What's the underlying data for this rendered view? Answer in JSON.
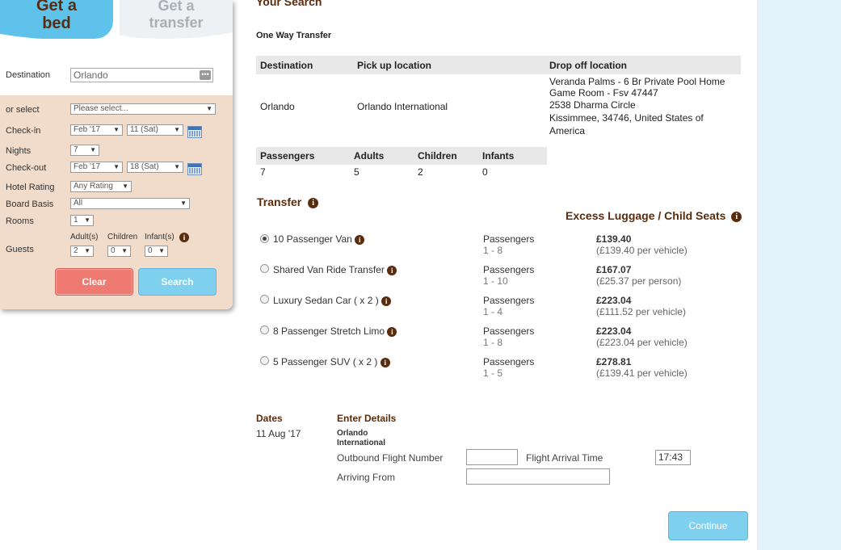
{
  "colors": {
    "brand_brown": "#5a2c0e",
    "sky": "#5ec2ea",
    "panel_bg": "#f1dccc",
    "clear_red": "#ef7a72",
    "search_blue": "#7fd0ef",
    "side_strip": "#e3f3fb"
  },
  "tabs": {
    "bed_line1": "Get a",
    "bed_line2": "bed",
    "transfer_line1": "Get a",
    "transfer_line2": "transfer"
  },
  "search_form": {
    "destination_label": "Destination",
    "destination_value": "Orlando",
    "destination_btn": "•••",
    "or_select_label": "or select",
    "or_select_value": "Please select...",
    "checkin_label": "Check-in",
    "checkin_month": "Feb '17",
    "checkin_day": "11 (Sat)",
    "nights_label": "Nights",
    "nights_value": "7",
    "checkout_label": "Check-out",
    "checkout_month": "Feb '17",
    "checkout_day": "18 (Sat)",
    "rating_label": "Hotel Rating",
    "rating_value": "Any Rating",
    "board_label": "Board Basis",
    "board_value": "All",
    "rooms_label": "Rooms",
    "rooms_value": "1",
    "guests_label": "Guests",
    "adults_label": "Adult(s)",
    "adults_value": "2",
    "children_label": "Children",
    "children_value": "0",
    "infants_label": "Infant(s)",
    "infants_value": "0",
    "clear_label": "Clear",
    "search_label": "Search"
  },
  "summary": {
    "title": "Your Search",
    "subtitle": "One Way Transfer",
    "headers": [
      "Destination",
      "Pick up location",
      "Drop off location"
    ],
    "destination": "Orlando",
    "pickup": "Orlando International",
    "dropoff_lines": [
      "Veranda Palms - 6 Br Private Pool Home",
      "Game Room - Fsv 47447",
      "2538 Dharma Circle",
      "Kissimmee, 34746, United States of",
      "America"
    ],
    "pax_headers": [
      "Passengers",
      "Adults",
      "Children",
      "Infants"
    ],
    "pax_values": [
      "7",
      "5",
      "2",
      "0"
    ]
  },
  "transfer": {
    "heading": "Transfer",
    "excess_heading": "Excess Luggage / Child Seats",
    "passengers_label": "Passengers",
    "options": [
      {
        "name": "10 Passenger Van",
        "pax": "1 - 8",
        "price": "£139.40",
        "note": "(£139.40 per vehicle)",
        "selected": true
      },
      {
        "name": "Shared Van Ride Transfer",
        "pax": "1 - 10",
        "price": "£167.07",
        "note": "(£25.37 per person)",
        "selected": false
      },
      {
        "name": "Luxury Sedan Car ( x 2 )",
        "pax": "1 - 4",
        "price": "£223.04",
        "note": "(£111.52 per vehicle)",
        "selected": false
      },
      {
        "name": "8 Passenger Stretch Limo",
        "pax": "1 - 8",
        "price": "£223.04",
        "note": "(£223.04 per vehicle)",
        "selected": false
      },
      {
        "name": "5 Passenger SUV ( x 2 )",
        "pax": "1 - 5",
        "price": "£278.81",
        "note": "(£139.41 per vehicle)",
        "selected": false
      }
    ]
  },
  "details": {
    "dates_label": "Dates",
    "date_value": "11 Aug '17",
    "enter_label": "Enter Details",
    "location_line1": "Orlando",
    "location_line2": "International",
    "outbound_label": "Outbound Flight Number",
    "outbound_value": "",
    "arrival_time_label": "Flight Arrival Time",
    "arrival_time_value": "17:43",
    "arriving_from_label": "Arriving From",
    "arriving_from_value": ""
  },
  "continue_label": "Continue"
}
